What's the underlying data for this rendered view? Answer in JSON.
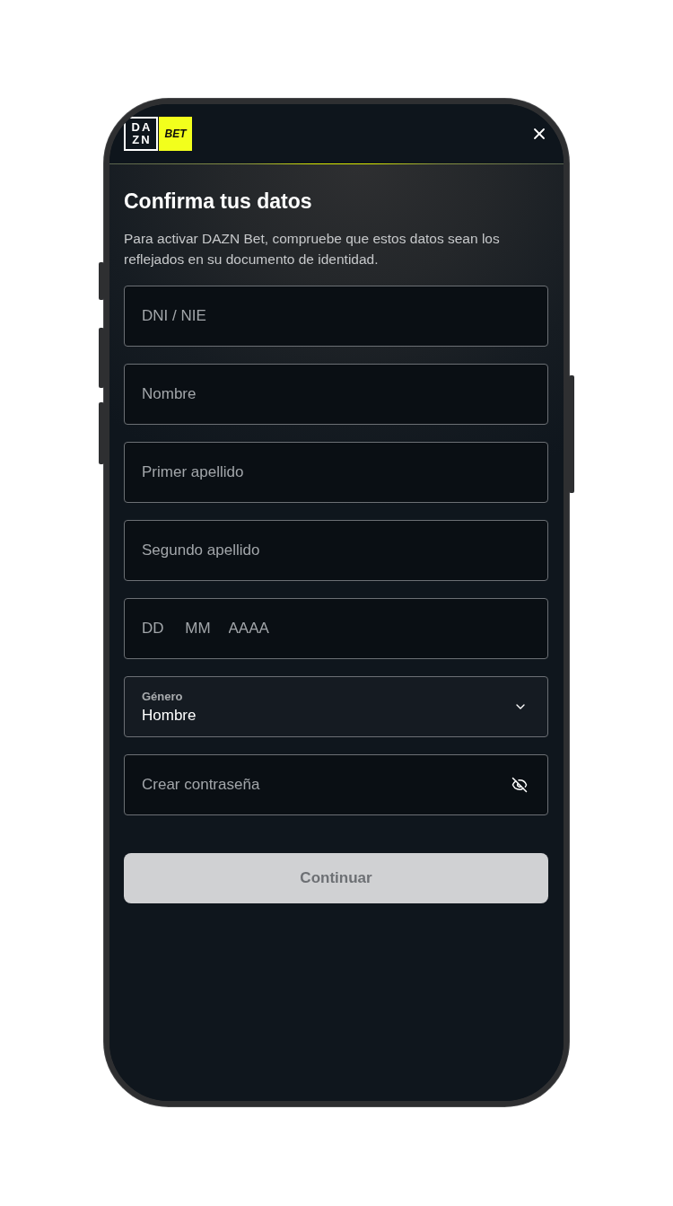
{
  "header": {
    "logo": {
      "wordmark_lines": [
        "DA",
        "ZN"
      ],
      "badge": "BET"
    }
  },
  "title": "Confirma tus datos",
  "subtitle": "Para activar DAZN Bet, compruebe que estos datos sean los reflejados en su documento de identidad.",
  "fields": [
    {
      "kind": "text",
      "placeholder": "DNI / NIE"
    },
    {
      "kind": "text",
      "placeholder": "Nombre"
    },
    {
      "kind": "text",
      "placeholder": "Primer apellido"
    },
    {
      "kind": "text",
      "placeholder": "Segundo apellido"
    },
    {
      "kind": "date",
      "parts": [
        {
          "placeholder": "DD"
        },
        {
          "placeholder": "MM"
        },
        {
          "placeholder": "AAAA"
        }
      ]
    },
    {
      "kind": "select",
      "label": "Género",
      "value": "Hombre"
    },
    {
      "kind": "password",
      "placeholder": "Crear contraseña"
    }
  ],
  "button": {
    "label": "Continuar",
    "disabled": true
  }
}
